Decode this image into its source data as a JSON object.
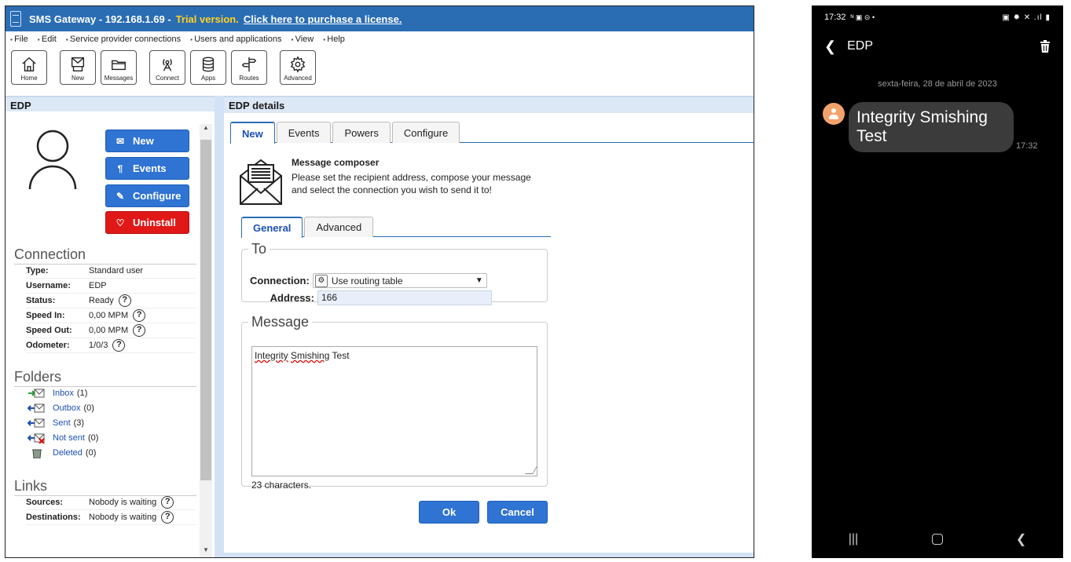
{
  "window": {
    "title": "SMS Gateway - 192.168.1.69 -",
    "trial": "Trial version.",
    "purchase_link": "Click here to purchase a license."
  },
  "menu": [
    "File",
    "Edit",
    "Service provider connections",
    "Users and applications",
    "View",
    "Help"
  ],
  "toolbar": {
    "home": "Home",
    "new": "New",
    "messages": "Messages",
    "connect": "Connect",
    "apps": "Apps",
    "routes": "Routes",
    "advanced": "Advanced"
  },
  "left": {
    "header": "EDP",
    "buttons": {
      "new": "New",
      "events": "Events",
      "configure": "Configure",
      "uninstall": "Uninstall"
    },
    "connection": {
      "title": "Connection",
      "rows": [
        {
          "key": "Type:",
          "value": "Standard user"
        },
        {
          "key": "Username:",
          "value": "EDP"
        },
        {
          "key": "Status:",
          "value": "Ready"
        },
        {
          "key": "Speed In:",
          "value": "0,00 MPM"
        },
        {
          "key": "Speed Out:",
          "value": "0,00 MPM"
        },
        {
          "key": "Odometer:",
          "value": "1/0/3"
        }
      ]
    },
    "folders": {
      "title": "Folders",
      "items": [
        {
          "name": "Inbox",
          "count": "(1)"
        },
        {
          "name": "Outbox",
          "count": "(0)"
        },
        {
          "name": "Sent",
          "count": "(3)"
        },
        {
          "name": "Not sent",
          "count": "(0)"
        },
        {
          "name": "Deleted",
          "count": "(0)"
        }
      ]
    },
    "links": {
      "title": "Links",
      "rows": [
        {
          "key": "Sources:",
          "value": "Nobody is waiting"
        },
        {
          "key": "Destinations:",
          "value": "Nobody is waiting"
        }
      ]
    },
    "help_glyph": "?"
  },
  "right": {
    "header": "EDP details",
    "tabs": [
      "New",
      "Events",
      "Powers",
      "Configure"
    ],
    "composer": {
      "title": "Message composer",
      "description": "Please set the recipient address, compose your message and select the connection you wish to send it to!"
    },
    "subtabs": [
      "General",
      "Advanced"
    ],
    "to": {
      "legend": "To",
      "connection_label": "Connection:",
      "connection_value": "Use routing table",
      "address_label": "Address:",
      "address_value": "166"
    },
    "message": {
      "legend": "Message",
      "word1": "Integrity",
      "word2": "Smishing",
      "word3": "Test",
      "counter": "23 characters."
    },
    "ok": "Ok",
    "cancel": "Cancel"
  },
  "phone": {
    "time": "17:32",
    "status_extra": "ᴺ ▣ ⊝ •",
    "status_right": "▣ ✹ ✕ .ıl ▮",
    "contact": "EDP",
    "date": "sexta-feira, 28 de abril de 2023",
    "message": "Integrity Smishing Test",
    "message_time": "17:32"
  },
  "colors": {
    "titlebar": "#2a6db3",
    "trial": "#ffd21f",
    "button_blue": "#2f73d3",
    "button_red": "#e01818",
    "phone_bubble": "#3b3b3b"
  }
}
